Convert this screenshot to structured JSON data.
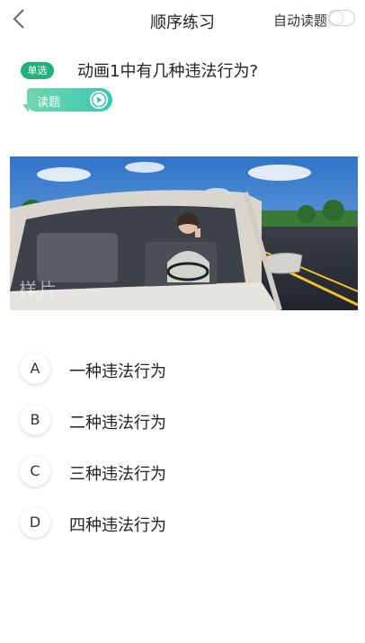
{
  "header": {
    "back_icon": "chevron-left-icon",
    "title": "顺序练习",
    "auto_read_label": "自动读题",
    "auto_read_on": false
  },
  "question": {
    "type_badge": "单选",
    "text": "动画1中有几种违法行为?",
    "read_button_label": "读题",
    "read_button_icon": "play-circle-icon",
    "image_watermark": "样片"
  },
  "options": [
    {
      "letter": "A",
      "text": "一种违法行为"
    },
    {
      "letter": "B",
      "text": "二种违法行为"
    },
    {
      "letter": "C",
      "text": "三种违法行为"
    },
    {
      "letter": "D",
      "text": "四种违法行为"
    }
  ],
  "colors": {
    "accent_green": "#23b07a",
    "read_gradient_start": "#6fd6ac",
    "read_gradient_end": "#3bc8b6"
  }
}
